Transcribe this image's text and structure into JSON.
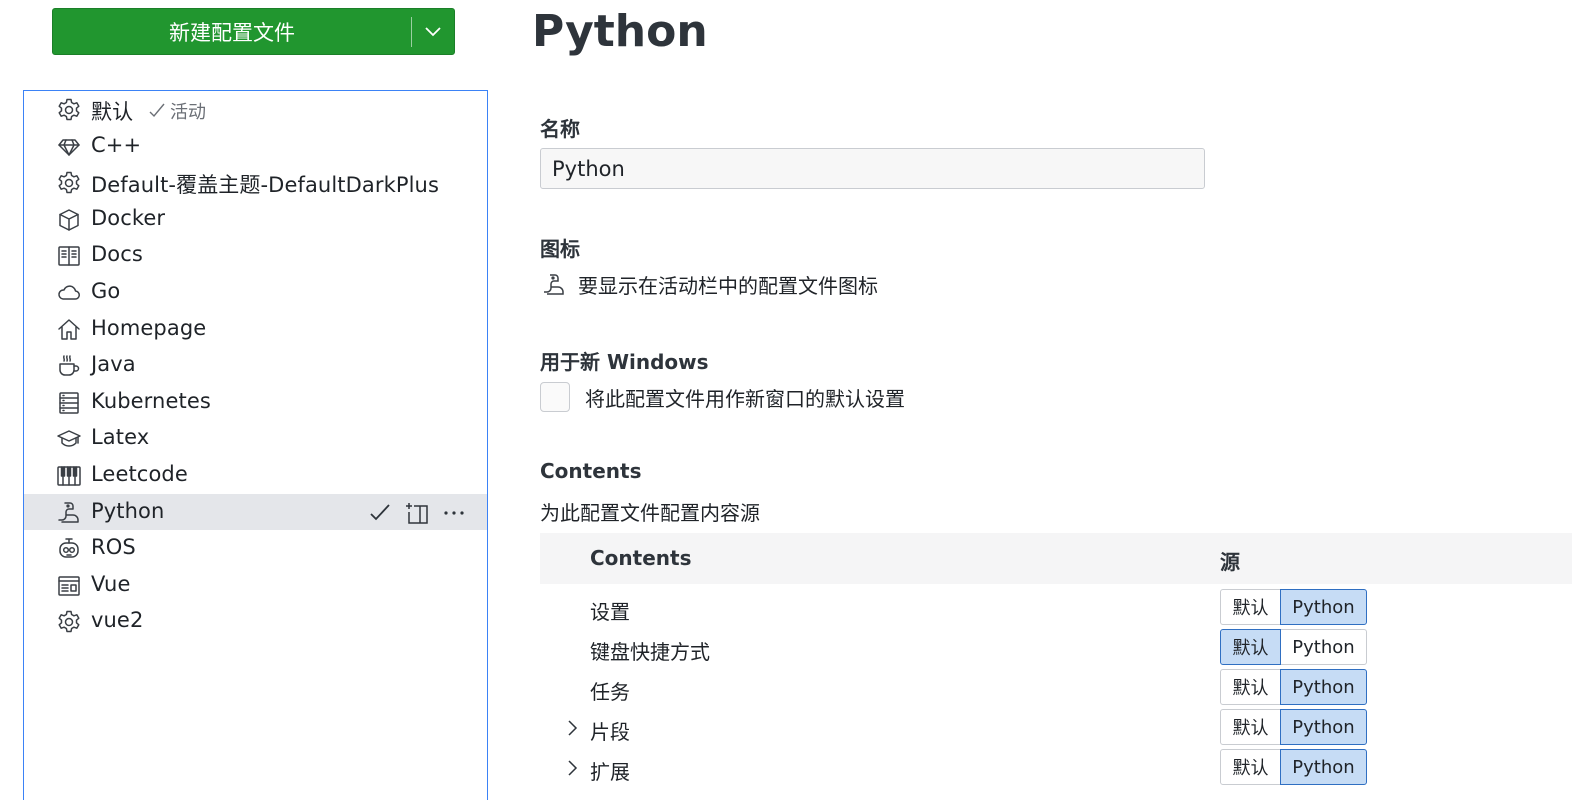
{
  "new_profile_button": {
    "label": "新建配置文件"
  },
  "profiles": [
    {
      "name": "默认",
      "icon": "gear-icon",
      "active_label": "活动"
    },
    {
      "name": "C++",
      "icon": "ruby-icon"
    },
    {
      "name": "Default-覆盖主题-DefaultDarkPlus",
      "icon": "gear-icon"
    },
    {
      "name": "Docker",
      "icon": "package-icon"
    },
    {
      "name": "Docs",
      "icon": "book-icon"
    },
    {
      "name": "Go",
      "icon": "cloud-icon"
    },
    {
      "name": "Homepage",
      "icon": "home-icon"
    },
    {
      "name": "Java",
      "icon": "coffee-icon"
    },
    {
      "name": "Kubernetes",
      "icon": "server-icon"
    },
    {
      "name": "Latex",
      "icon": "mortar-board-icon"
    },
    {
      "name": "Leetcode",
      "icon": "piano-icon"
    },
    {
      "name": "Python",
      "icon": "snake-icon",
      "selected": true
    },
    {
      "name": "ROS",
      "icon": "robot-icon"
    },
    {
      "name": "Vue",
      "icon": "layout-icon"
    },
    {
      "name": "vue2",
      "icon": "gear-icon"
    }
  ],
  "detail": {
    "title": "Python",
    "name_label": "名称",
    "name_value": "Python",
    "icon_label": "图标",
    "icon_name": "snake-icon",
    "icon_desc": "要显示在活动栏中的配置文件图标",
    "new_windows_label": "用于新 Windows",
    "new_windows_desc": "将此配置文件用作新窗口的默认设置",
    "new_windows_checked": false,
    "contents_label": "Contents",
    "contents_desc": "为此配置文件配置内容源",
    "table_headers": {
      "contents": "Contents",
      "source": "源"
    },
    "option_default": "默认",
    "option_profile": "Python",
    "rows": [
      {
        "label": "设置",
        "expandable": false,
        "source": "Python"
      },
      {
        "label": "键盘快捷方式",
        "expandable": false,
        "source": "默认"
      },
      {
        "label": "任务",
        "expandable": false,
        "source": "Python"
      },
      {
        "label": "片段",
        "expandable": true,
        "source": "Python"
      },
      {
        "label": "扩展",
        "expandable": true,
        "source": "Python"
      }
    ]
  },
  "colors": {
    "primary_button": "#21962f",
    "focus_border": "#3b82f6",
    "selected_row": "#e4e6ea",
    "toggle_on_bg": "#c6dcf5",
    "toggle_on_border": "#2f6fc2"
  }
}
